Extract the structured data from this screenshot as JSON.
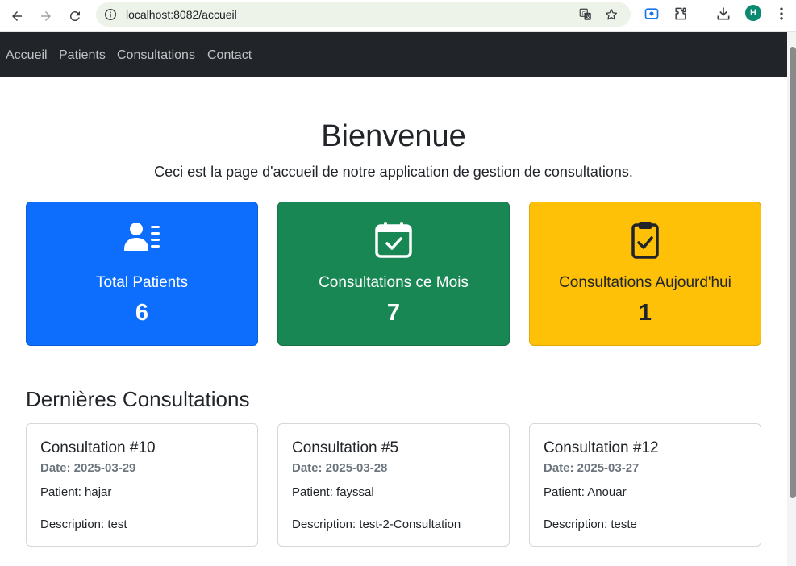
{
  "browser": {
    "url": "localhost:8082/accueil",
    "avatar_letter": "H"
  },
  "nav": {
    "links": [
      "Accueil",
      "Patients",
      "Consultations",
      "Contact"
    ]
  },
  "hero": {
    "title": "Bienvenue",
    "subtitle": "Ceci est la page d'accueil de notre application de gestion de consultations."
  },
  "stats": [
    {
      "icon": "patient-list-icon",
      "label": "Total Patients",
      "value": "6",
      "color": "#0d6efd"
    },
    {
      "icon": "calendar-check-icon",
      "label": "Consultations ce Mois",
      "value": "7",
      "color": "#198754"
    },
    {
      "icon": "clipboard-check-icon",
      "label": "Consultations Aujourd'hui",
      "value": "1",
      "color": "#ffc107"
    }
  ],
  "recent": {
    "title": "Dernières Consultations",
    "items": [
      {
        "title": "Consultation #10",
        "date": "Date: 2025-03-29",
        "patient": "Patient: hajar",
        "description": "Description: test"
      },
      {
        "title": "Consultation #5",
        "date": "Date: 2025-03-28",
        "patient": "Patient: fayssal",
        "description": "Description: test-2-Consultation"
      },
      {
        "title": "Consultation #12",
        "date": "Date: 2025-03-27",
        "patient": "Patient: Anouar",
        "description": "Description: teste"
      }
    ]
  }
}
